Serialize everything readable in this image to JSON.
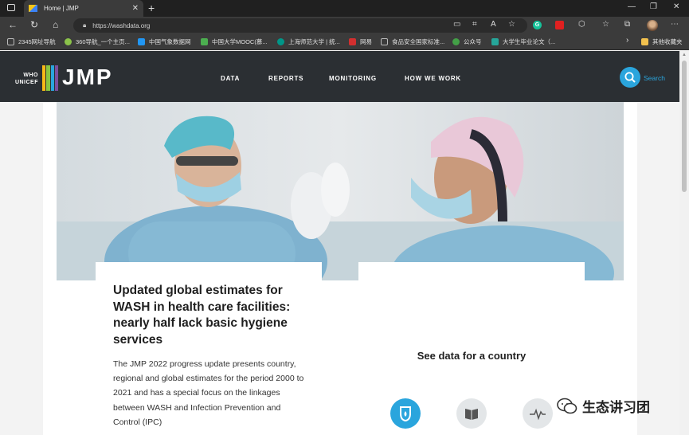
{
  "browser": {
    "tab_title": "Home | JMP",
    "tab_close": "✕",
    "new_tab": "+",
    "url": "https://washdata.org",
    "window_controls": [
      "—",
      "❐",
      "✕"
    ],
    "bookmarks": [
      {
        "label": "2345网址导航",
        "color": "#bbbbbb"
      },
      {
        "label": "360导航_一个主页...",
        "color": "#8bc34a"
      },
      {
        "label": "中国气象数据网",
        "color": "#2196f3"
      },
      {
        "label": "中国大学MOOC(慕...",
        "color": "#4caf50"
      },
      {
        "label": "上海师范大学 | 统...",
        "color": "#009688"
      },
      {
        "label": "网易",
        "color": "#d32f2f"
      },
      {
        "label": "食品安全国家标准...",
        "color": "#bbbbbb"
      },
      {
        "label": "公众号",
        "color": "#43a047"
      },
      {
        "label": "大学生毕业论文（...",
        "color": "#26a69a"
      }
    ],
    "bookmarks_more": "›",
    "other_bookmarks": "其他收藏夹"
  },
  "site": {
    "logo_who": "WHO",
    "logo_unicef": "UNICEF",
    "logo_text": "JMP",
    "logo_colors": [
      "#f6b817",
      "#8bc53f",
      "#2aa5dd",
      "#7b4f9d"
    ],
    "nav": [
      "DATA",
      "REPORTS",
      "MONITORING",
      "HOW WE WORK"
    ],
    "search_label": "Search",
    "accent": "#2aa5dd",
    "header_bg": "#2b2f33"
  },
  "feature": {
    "title": "Updated global estimates for WASH in health care facilities: nearly half lack basic hygiene services",
    "body": "The JMP 2022 progress update presents country, regional and global estimates for the period 2000 to 2021 and has a special focus on the linkages between WASH and Infection Prevention and Control (IPC)"
  },
  "country_card": {
    "heading": "See data for a country"
  },
  "watermark": {
    "text": "生态讲习团"
  }
}
